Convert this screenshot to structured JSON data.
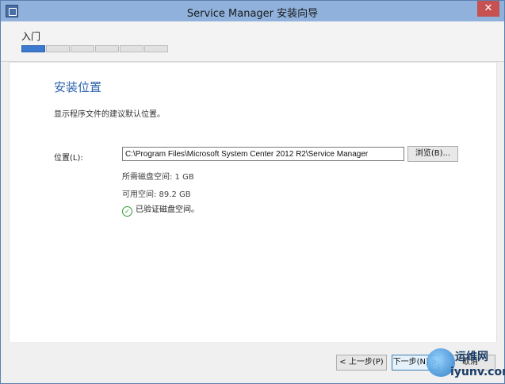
{
  "window": {
    "title": "Service Manager 安装向导",
    "close_glyph": "✕"
  },
  "header": {
    "stage": "入门",
    "progress": {
      "total_steps": 6,
      "current_step": 1
    }
  },
  "main": {
    "title": "安装位置",
    "description": "显示程序文件的建议默认位置。",
    "location_label": "位置(L):",
    "location_value": "C:\\Program Files\\Microsoft System Center 2012 R2\\Service Manager",
    "browse_label": "浏览(B)...",
    "required_space": "所需磁盘空间: 1 GB",
    "available_space": "可用空间: 89.2 GB",
    "verified_text": "已验证磁盘空间。"
  },
  "footer": {
    "back_label": "< 上一步(P)",
    "next_label": "下一步(N) >",
    "cancel_label": "取消"
  },
  "watermark": {
    "line1": "运维网",
    "line2": "iyunv.com"
  },
  "colors": {
    "accent": "#2a61ad",
    "progress_active": "#3c7ad0",
    "success": "#2e9a36",
    "titlebar": "#8fb1dc"
  }
}
